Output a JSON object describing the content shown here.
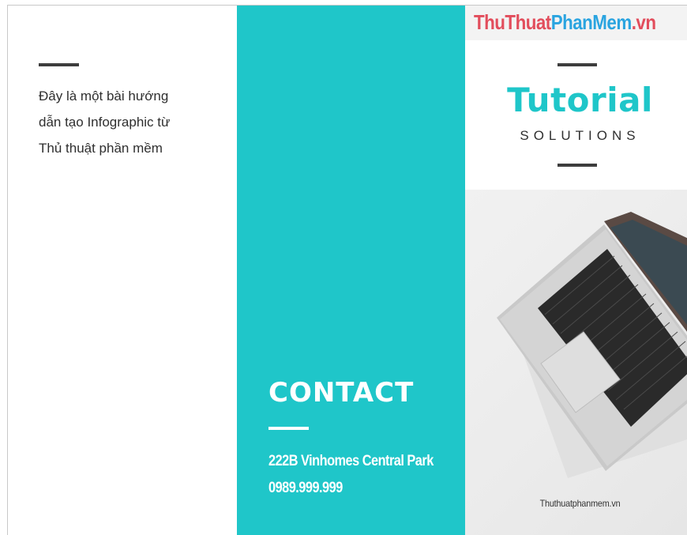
{
  "left_panel": {
    "lines": [
      "Đây là một bài hướng",
      "dẫn tạo Infographic từ",
      "Thủ thuật phần mềm"
    ]
  },
  "middle_panel": {
    "contact_title": "CONTACT",
    "address": "222B Vinhomes Central Park",
    "phone": "0989.999.999"
  },
  "right_panel": {
    "brand_parts": [
      "ThuThuat",
      "PhanMem",
      ".vn"
    ],
    "title": "Tutorial",
    "subtitle": "SOLUTIONS",
    "image_subject": "laptop-photo",
    "footer_url": "Thuthuatphanmem.vn"
  },
  "colors": {
    "teal": "#1fc6c9",
    "dark": "#3d3d3d",
    "brand_red": "#e24d5c",
    "brand_blue": "#2aa4e0"
  }
}
